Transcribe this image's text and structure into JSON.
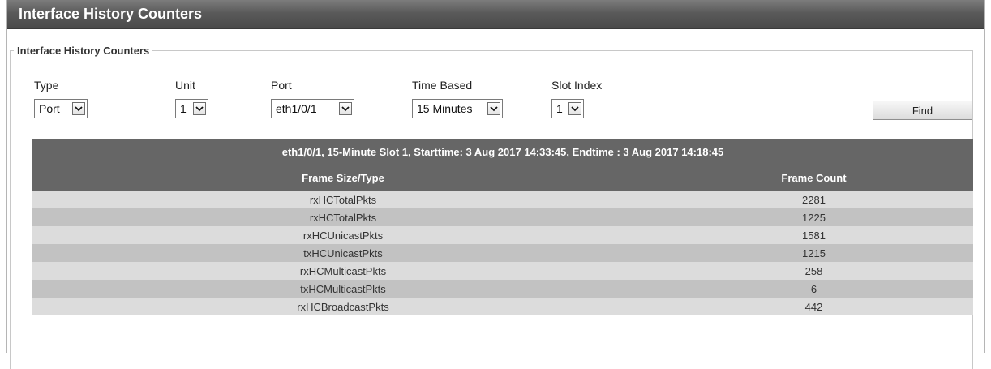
{
  "page": {
    "title": "Interface History Counters"
  },
  "group": {
    "legend": "Interface History Counters"
  },
  "filters": {
    "type": {
      "label": "Type",
      "value": "Port"
    },
    "unit": {
      "label": "Unit",
      "value": "1"
    },
    "port": {
      "label": "Port",
      "value": "eth1/0/1"
    },
    "time_based": {
      "label": "Time Based",
      "value": "15 Minutes"
    },
    "slot_index": {
      "label": "Slot Index",
      "value": "1"
    }
  },
  "find_button": "Find",
  "table": {
    "caption": "eth1/0/1, 15-Minute Slot 1, Starttime: 3 Aug 2017 14:33:45, Endtime : 3 Aug 2017 14:18:45",
    "columns": [
      "Frame Size/Type",
      "Frame Count"
    ],
    "rows": [
      [
        "rxHCTotalPkts",
        "2281"
      ],
      [
        "rxHCTotalPkts",
        "1225"
      ],
      [
        "rxHCUnicastPkts",
        "1581"
      ],
      [
        "txHCUnicastPkts",
        "1215"
      ],
      [
        "rxHCMulticastPkts",
        "258"
      ],
      [
        "txHCMulticastPkts",
        "6"
      ],
      [
        "rxHCBroadcastPkts",
        "442"
      ]
    ]
  }
}
